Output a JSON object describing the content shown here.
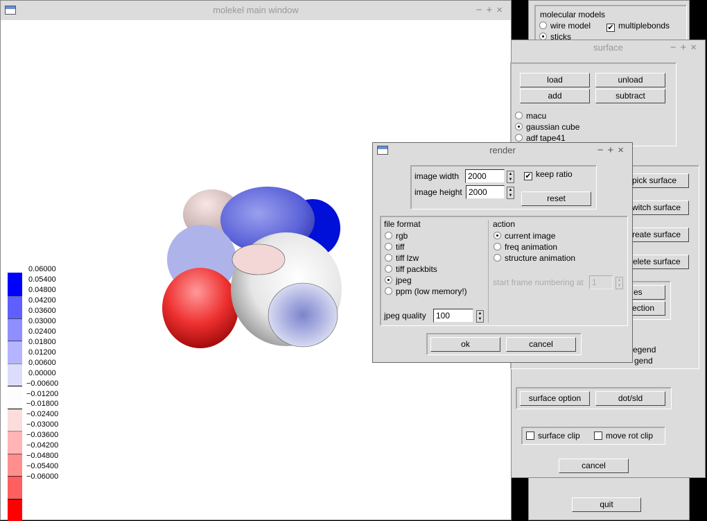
{
  "main_window": {
    "title": "molekel main window",
    "controls": [
      "−",
      "+",
      "×"
    ]
  },
  "legend": {
    "labels": [
      "0.06000",
      "0.05400",
      "0.04800",
      "0.04200",
      "0.03600",
      "0.03000",
      "0.02400",
      "0.01800",
      "0.01200",
      "0.00600",
      "0.00000",
      "−0.00600",
      "−0.01200",
      "−0.01800",
      "−0.02400",
      "−0.03000",
      "−0.03600",
      "−0.04200",
      "−0.04800",
      "−0.05400",
      "−0.06000"
    ],
    "colors": [
      "#0000ff",
      "#5f5fff",
      "#8f8fff",
      "#b5b5ff",
      "#dcdcfd",
      "#fdfdfd",
      "#fddcdc",
      "#ffb5b5",
      "#ff8f8f",
      "#ff5f5f",
      "#ff0000"
    ]
  },
  "back_window": {
    "group_title": "molecular models",
    "wire_model": "wire model",
    "sticks": "sticks",
    "multiplebonds": "multiplebonds",
    "quit": "quit"
  },
  "surface": {
    "title": "surface",
    "controls": [
      "−",
      "+",
      "×"
    ],
    "load": "load",
    "unload": "unload",
    "add": "add",
    "subtract": "subtract",
    "radios": [
      {
        "label": "macu",
        "checked": false
      },
      {
        "label": "gaussian cube",
        "checked": true
      },
      {
        "label": "adf tape41",
        "checked": false
      }
    ],
    "pick": "pick surface",
    "switch": "switch surface",
    "create": "create surface",
    "delete": "delete surface",
    "frag1": "es",
    "frag2": "ection",
    "frag3": "egend",
    "frag4": "gend",
    "surface_option": "surface option",
    "dot_sld": "dot/sld",
    "surface_clip": "surface clip",
    "move_rot_clip": "move rot clip",
    "cancel": "cancel"
  },
  "render": {
    "title": "render",
    "controls": [
      "−",
      "+",
      "×"
    ],
    "image_width_label": "image width",
    "image_width": "2000",
    "image_height_label": "image height",
    "image_height": "2000",
    "keep_ratio": "keep ratio",
    "keep_ratio_checked": true,
    "reset": "reset",
    "file_format_label": "file format",
    "formats": [
      {
        "label": "rgb",
        "checked": false
      },
      {
        "label": "tiff",
        "checked": false
      },
      {
        "label": "tiff lzw",
        "checked": false
      },
      {
        "label": "tiff packbits",
        "checked": false
      },
      {
        "label": "jpeg",
        "checked": true
      },
      {
        "label": "ppm (low memory!)",
        "checked": false
      }
    ],
    "jpeg_quality_label": "jpeg quality",
    "jpeg_quality": "100",
    "action_label": "action",
    "actions": [
      {
        "label": "current image",
        "checked": true
      },
      {
        "label": "freq animation",
        "checked": false
      },
      {
        "label": "structure animation",
        "checked": false
      }
    ],
    "start_frame_label": "start frame numbering at",
    "start_frame": "1",
    "ok": "ok",
    "cancel": "cancel"
  }
}
